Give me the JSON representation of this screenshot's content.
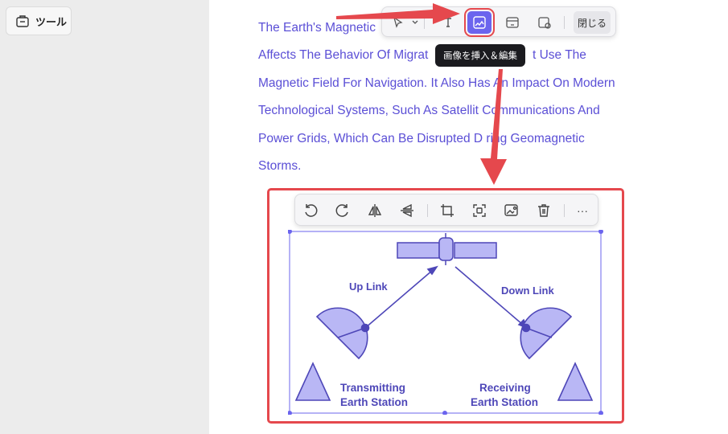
{
  "sidebar": {
    "tools_label": "ツール"
  },
  "document": {
    "lines": [
      "The Earth's Magnetic",
      "Affects The Behavior Of Migrat",
      "Magnetic Field For Navigation. It Also Has An Impact On Modern",
      "Technological Systems, Such As Satellit  Communications And",
      "Power Grids, Which Can Be Disrupted D ring Geomagnetic",
      "Storms."
    ],
    "line2_tail": "t Use The"
  },
  "top_toolbar": {
    "close_label": "閉じる",
    "tooltip": "画像を挿入＆編集",
    "icons": [
      "select-icon",
      "dropdown-icon",
      "text-icon",
      "insert-image-icon",
      "link-icon",
      "location-icon"
    ]
  },
  "image_toolbar": {
    "icons": [
      "rotate-left-icon",
      "rotate-right-icon",
      "flip-horizontal-icon",
      "flip-vertical-icon",
      "crop-icon",
      "replace-icon",
      "extract-image-icon",
      "delete-icon",
      "more-icon"
    ],
    "more_label": "···"
  },
  "diagram": {
    "uplink": "Up Link",
    "downlink": "Down Link",
    "transmit_1": "Transmitting",
    "transmit_2": "Earth Station",
    "receive_1": "Receiving",
    "receive_2": "Earth Station"
  },
  "colors": {
    "accent": "#6b64ee",
    "highlight": "#e5484d",
    "text_purple": "#5b4fd6",
    "diagram_fill": "#b9b7f5",
    "diagram_stroke": "#4e47b8"
  }
}
